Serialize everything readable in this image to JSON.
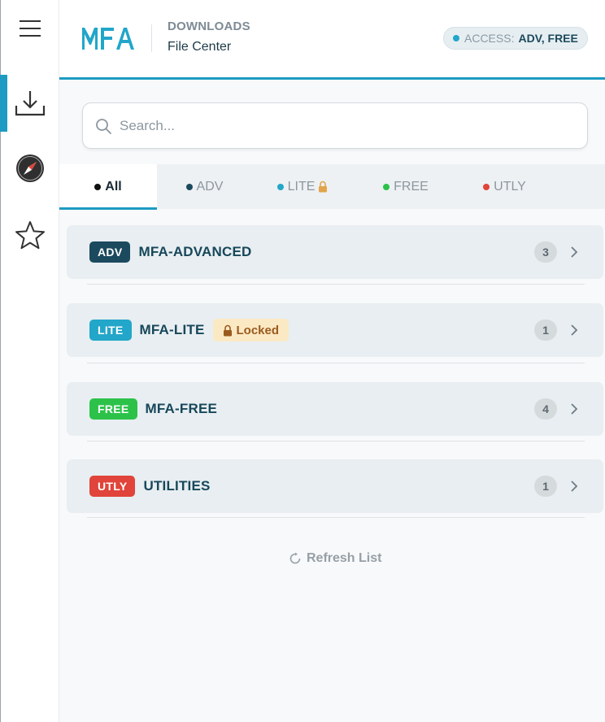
{
  "sidebar": {
    "items": [
      {
        "icon": "menu-icon"
      },
      {
        "icon": "download-icon",
        "active": true
      },
      {
        "icon": "compass-icon"
      },
      {
        "icon": "star-icon"
      }
    ],
    "active_color": "#1d9bc2"
  },
  "header": {
    "logo_text": "MFA",
    "title": "DOWNLOADS",
    "subtitle": "File Center",
    "access_label": "ACCESS:",
    "access_value": "ADV, FREE"
  },
  "search": {
    "placeholder": "Search...",
    "value": ""
  },
  "tabs": [
    {
      "label": "All",
      "dot_color": "#111111",
      "active": true
    },
    {
      "label": "ADV",
      "dot_color": "#1b4a5e"
    },
    {
      "label": "LITE",
      "dot_color": "#22a6c9",
      "locked": true
    },
    {
      "label": "FREE",
      "dot_color": "#2cc24a"
    },
    {
      "label": "UTLY",
      "dot_color": "#e0443a"
    }
  ],
  "categories": [
    {
      "badge": "ADV",
      "badge_color": "#1b4a5e",
      "name": "MFA-ADVANCED",
      "count": "3"
    },
    {
      "badge": "LITE",
      "badge_color": "#22a6c9",
      "name": "MFA-LITE",
      "locked_label": "Locked",
      "count": "1"
    },
    {
      "badge": "FREE",
      "badge_color": "#2cc24a",
      "name": "MFA-FREE",
      "count": "4"
    },
    {
      "badge": "UTLY",
      "badge_color": "#e0443a",
      "name": "UTILITIES",
      "count": "1"
    }
  ],
  "refresh_label": "Refresh List"
}
